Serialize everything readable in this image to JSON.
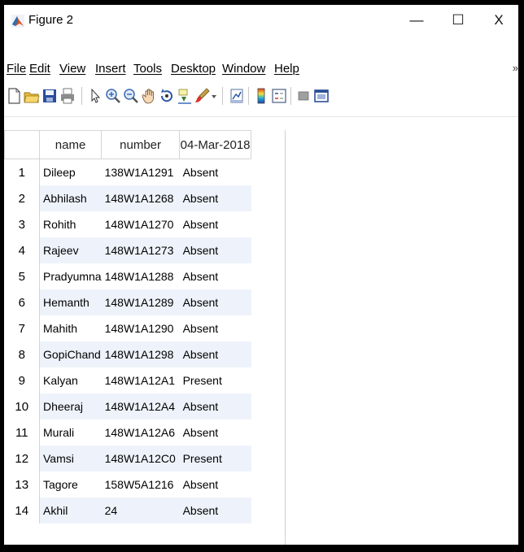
{
  "window": {
    "title": "Figure 2",
    "minimize_glyph": "—",
    "maximize_glyph": "☐",
    "close_glyph": "X"
  },
  "menu": {
    "items": [
      "File",
      "Edit",
      "View",
      "Insert",
      "Tools",
      "Desktop",
      "Window",
      "Help"
    ],
    "overflow": "»"
  },
  "toolbar": {
    "icons": [
      "new-figure-icon",
      "open-file-icon",
      "save-icon",
      "print-icon",
      "pointer-icon",
      "zoom-in-icon",
      "zoom-out-icon",
      "pan-icon",
      "rotate-3d-icon",
      "data-cursor-icon",
      "brush-icon",
      "dropdown-arrow-icon",
      "link-plot-icon",
      "colorbar-icon",
      "legend-icon",
      "hide-plot-tools-icon",
      "show-plot-tools-icon"
    ]
  },
  "table": {
    "columns": [
      "name",
      "number",
      "04-Mar-2018"
    ],
    "rows": [
      {
        "index": "1",
        "name": "Dileep",
        "number": "138W1A1291",
        "status": "Absent"
      },
      {
        "index": "2",
        "name": "Abhilash",
        "number": "148W1A1268",
        "status": "Absent"
      },
      {
        "index": "3",
        "name": "Rohith",
        "number": "148W1A1270",
        "status": "Absent"
      },
      {
        "index": "4",
        "name": "Rajeev",
        "number": "148W1A1273",
        "status": "Absent"
      },
      {
        "index": "5",
        "name": "Pradyumna",
        "number": "148W1A1288",
        "status": "Absent"
      },
      {
        "index": "6",
        "name": "Hemanth",
        "number": "148W1A1289",
        "status": "Absent"
      },
      {
        "index": "7",
        "name": "Mahith",
        "number": "148W1A1290",
        "status": "Absent"
      },
      {
        "index": "8",
        "name": "GopiChand",
        "number": "148W1A1298",
        "status": "Absent"
      },
      {
        "index": "9",
        "name": "Kalyan",
        "number": "148W1A12A1",
        "status": "Present"
      },
      {
        "index": "10",
        "name": "Dheeraj",
        "number": "148W1A12A4",
        "status": "Absent"
      },
      {
        "index": "11",
        "name": "Murali",
        "number": "148W1A12A6",
        "status": "Absent"
      },
      {
        "index": "12",
        "name": "Vamsi",
        "number": "148W1A12C0",
        "status": "Present"
      },
      {
        "index": "13",
        "name": "Tagore",
        "number": "158W5A1216",
        "status": "Absent"
      },
      {
        "index": "14",
        "name": "Akhil",
        "number": "24",
        "status": "Absent"
      }
    ]
  },
  "colors": {
    "stripe": "#eef3fb",
    "border": "#d5d5d5",
    "outer": "#000000"
  }
}
